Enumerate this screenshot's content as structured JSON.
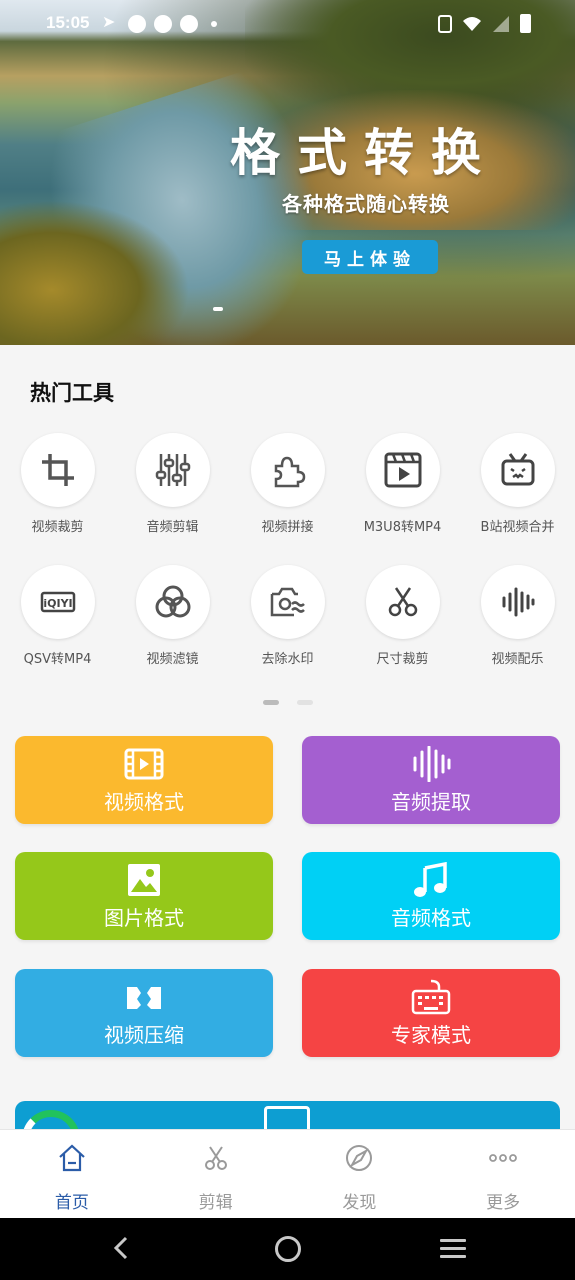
{
  "status": {
    "time": "15:05"
  },
  "banner": {
    "title": "格式转换",
    "subtitle": "各种格式随心转换",
    "button": "马上体验"
  },
  "hot_tools": {
    "title": "热门工具",
    "items": [
      {
        "label": "视频裁剪",
        "icon": "crop-icon"
      },
      {
        "label": "音频剪辑",
        "icon": "sliders-icon"
      },
      {
        "label": "视频拼接",
        "icon": "puzzle-icon"
      },
      {
        "label": "M3U8转MP4",
        "icon": "video-play-icon"
      },
      {
        "label": "B站视频合并",
        "icon": "bilibili-tv-icon"
      },
      {
        "label": "QSV转MP4",
        "icon": "iqiyi-icon"
      },
      {
        "label": "视频滤镜",
        "icon": "filter-circles-icon"
      },
      {
        "label": "去除水印",
        "icon": "camera-wave-icon"
      },
      {
        "label": "尺寸裁剪",
        "icon": "scissors-icon"
      },
      {
        "label": "视频配乐",
        "icon": "waveform-icon"
      }
    ]
  },
  "features": [
    {
      "label": "视频格式",
      "icon": "film-icon",
      "color": "#fbb92e"
    },
    {
      "label": "音频提取",
      "icon": "audio-bars-icon",
      "color": "#a45fd0"
    },
    {
      "label": "图片格式",
      "icon": "image-icon",
      "color": "#95c81a"
    },
    {
      "label": "音频格式",
      "icon": "music-note-icon",
      "color": "#00d0f5"
    },
    {
      "label": "视频压缩",
      "icon": "compress-icon",
      "color": "#32ade3"
    },
    {
      "label": "专家模式",
      "icon": "keyboard-icon",
      "color": "#f54444"
    }
  ],
  "nav": [
    {
      "label": "首页",
      "icon": "home-icon",
      "active": true
    },
    {
      "label": "剪辑",
      "icon": "scissors-icon"
    },
    {
      "label": "发现",
      "icon": "compass-icon"
    },
    {
      "label": "更多",
      "icon": "more-dots-icon"
    }
  ]
}
